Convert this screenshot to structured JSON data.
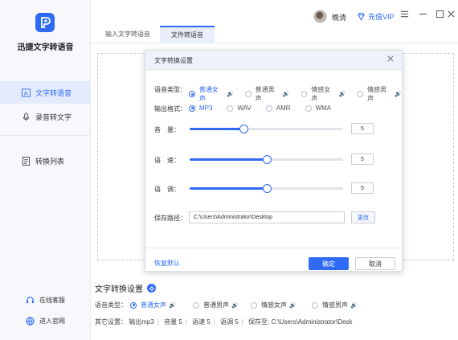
{
  "app": {
    "name": "迅捷文字转语音"
  },
  "sidebar": {
    "items": [
      {
        "label": "文字转语音",
        "icon": "text-to-speech-icon",
        "active": true
      },
      {
        "label": "录音转文字",
        "icon": "microphone-icon",
        "active": false
      },
      {
        "label": "转换列表",
        "icon": "list-icon",
        "active": false
      }
    ],
    "footer": [
      {
        "label": "在线客服",
        "icon": "headset-icon"
      },
      {
        "label": "进入官网",
        "icon": "globe-icon"
      }
    ]
  },
  "titlebar": {
    "username": "晚清",
    "vip_label": "充值VIP"
  },
  "tabs": [
    {
      "label": "输入文字转语音",
      "active": false
    },
    {
      "label": "文件转语音",
      "active": true
    }
  ],
  "dialog": {
    "title": "文字转换设置",
    "voice_label": "语音类型：",
    "voice_options": [
      {
        "label": "普通女声",
        "selected": true
      },
      {
        "label": "普通男声",
        "selected": false
      },
      {
        "label": "情感女声",
        "selected": false
      },
      {
        "label": "情感男声",
        "selected": false
      }
    ],
    "format_label": "输出格式：",
    "format_options": [
      {
        "label": "MP3",
        "selected": true
      },
      {
        "label": "WAV",
        "selected": false
      },
      {
        "label": "AMR",
        "selected": false
      },
      {
        "label": "WMA",
        "selected": false
      }
    ],
    "sliders": [
      {
        "label": "音　量：",
        "value": "5",
        "fraction": 0.35
      },
      {
        "label": "语　速：",
        "value": "5",
        "fraction": 0.5
      },
      {
        "label": "语　调：",
        "value": "5",
        "fraction": 0.5
      }
    ],
    "path_label": "保存路径：",
    "path_value": "C:\\Users\\Administrator\\Desktop",
    "change_button": "更改",
    "reset_link": "恢复默认",
    "ok_button": "确定",
    "cancel_button": "取消"
  },
  "bottom": {
    "title": "文字转换设置",
    "voice_label": "语音类型：",
    "voice_options": [
      {
        "label": "普通女声",
        "selected": true
      },
      {
        "label": "普通男声",
        "selected": false
      },
      {
        "label": "情感女声",
        "selected": false
      },
      {
        "label": "情感男声",
        "selected": false
      }
    ],
    "other_label": "其它设置：",
    "other_items": [
      "输出mp3",
      "音量 5",
      "语速 5",
      "语调 5",
      "保存至: C:\\Users\\Administrator\\Desk"
    ]
  },
  "colors": {
    "accent": "#2f6af5"
  }
}
